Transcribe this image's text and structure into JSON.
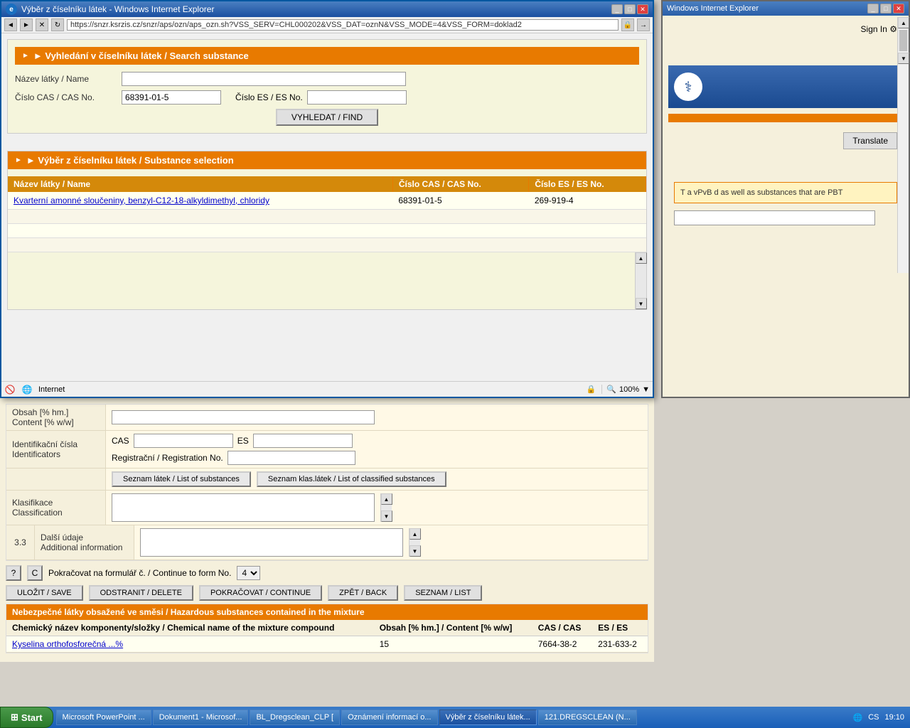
{
  "popup": {
    "title": "Výběr z číselníku látek - Windows Internet Explorer",
    "address": "https://snzr.ksrzis.cz/snzr/aps/ozn/aps_ozn.sh?VSS_SERV=CHL000202&VSS_DAT=oznN&VSS_MODE=4&VSS_FORM=doklad2",
    "search_section_title": "► Vyhledání v číselníku látek / Search substance",
    "name_label": "Název látky / Name",
    "cas_label": "Číslo CAS / CAS No.",
    "cas_value": "68391-01-5",
    "es_label": "Číslo ES / ES No.",
    "find_btn": "VYHLEDAT / FIND",
    "results_section_title": "► Výběr z číselníku látek / Substance selection",
    "results_col1": "Název látky / Name",
    "results_col2": "Číslo CAS / CAS No.",
    "results_col3": "Číslo ES / ES No.",
    "result_name": "Kvarterní amonné sloučeniny, benzyl-C12-18-alkyldimethyl, chloridy",
    "result_cas": "68391-01-5",
    "result_es": "269-919-4",
    "status_internet": "Internet",
    "status_zoom": "100%"
  },
  "main_form": {
    "content_label": "Obsah [% hm.]\nContent [% w/w]",
    "identifiers_label": "Identifikační čísla\nIdentificators",
    "cas_field_label": "CAS",
    "es_field_label": "ES",
    "reg_label": "Registrační / Registration No.",
    "btn_seznam_latek": "Seznam látek / List of substances",
    "btn_seznam_klas": "Seznam klas.látek / List of classified substances",
    "klasifikace_label": "Klasifikace\nClassification",
    "dalsi_udaje_label": "Další údaje\nAdditional information",
    "row_num": "3.3",
    "continue_label": "Pokračovat na formulář č. / Continue to form No.",
    "continue_value": "4",
    "btn_ulozit": "ULOŽIT / SAVE",
    "btn_odstranit": "ODSTRANIT / DELETE",
    "btn_pokracovat": "POKRAČOVAT / CONTINUE",
    "btn_zpet": "ZPĚT / BACK",
    "btn_seznam": "SEZNAM / LIST",
    "hazardous_header": "Nebezpečné látky obsažené ve směsi / Hazardous substances contained in the mixture",
    "hazardous_col1": "Chemický název komponenty/složky / Chemical name of the mixture compound",
    "hazardous_col2": "Obsah [% hm.] / Content [% w/w]",
    "hazardous_col3": "CAS / CAS",
    "hazardous_col4": "ES / ES",
    "hazardous_row1_name": "Kyselina orthofosforečná ...%",
    "hazardous_row1_content": "15",
    "hazardous_row1_cas": "7664-38-2",
    "hazardous_row1_es": "231-633-2"
  },
  "bg_browser": {
    "sign_in": "Sign In",
    "translate_btn": "Translate",
    "pbt_text": "T a vPvB\nd as well as substances that are PBT",
    "yahoo_placeholder": ""
  },
  "taskbar": {
    "start_label": "Start",
    "items": [
      {
        "label": "Microsoft PowerPoint ...",
        "active": false
      },
      {
        "label": "Dokument1 - Microsof...",
        "active": false
      },
      {
        "label": "BL_Dregsclean_CLP [",
        "active": false
      },
      {
        "label": "Oznámení informací o...",
        "active": false
      },
      {
        "label": "Výběr z číselníku látek...",
        "active": true
      },
      {
        "label": "121.DREGSCLEAN (N...",
        "active": false
      }
    ],
    "time": "19:10",
    "cs_label": "CS"
  }
}
